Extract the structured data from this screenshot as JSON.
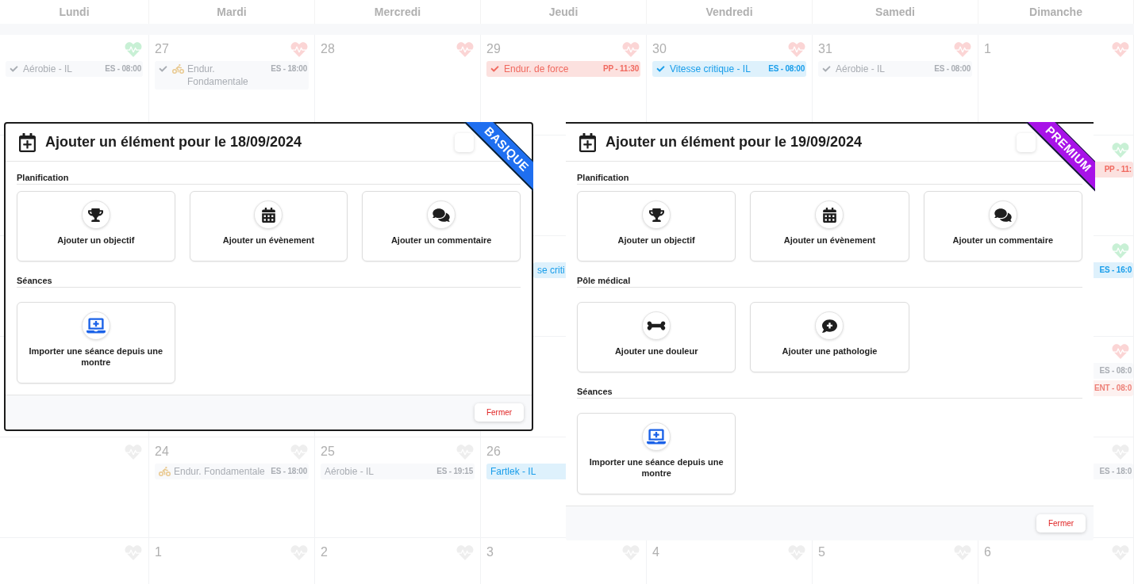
{
  "calendar": {
    "day_names": [
      "Lundi",
      "Mardi",
      "Mercredi",
      "Jeudi",
      "Vendredi",
      "Samedi",
      "Dimanche"
    ],
    "weeks": [
      {
        "days": [
          {
            "color": "#c8f0d5",
            "events": [
              {
                "kind": "workout",
                "completed": true,
                "title": "Aérobie - IL",
                "time": "ES - 08:00",
                "color": "#f8f9fb"
              }
            ]
          },
          {
            "number": "27",
            "color": "#fbd5d5",
            "events": [
              {
                "kind": "cycling",
                "completed": true,
                "title": "Endur. Fondamentale",
                "time": "ES - 18:00",
                "color": "#f8f9fb"
              }
            ]
          },
          {
            "number": "28",
            "color": "#fbd5d5"
          },
          {
            "number": "29",
            "color": "#fbd5d5",
            "events": [
              {
                "kind": "workout",
                "completed": true,
                "title": "Endur. de force",
                "time": "PP - 11:30",
                "color": "#fce1df"
              }
            ]
          },
          {
            "number": "30",
            "color": "#fbd5d5",
            "events": [
              {
                "kind": "workout",
                "completed": true,
                "title": "Vitesse critique - IL",
                "time": "ES - 08:00",
                "color": "#def1fc"
              }
            ]
          },
          {
            "number": "31",
            "color": "#fbd5d5",
            "events": [
              {
                "kind": "workout",
                "completed": true,
                "title": "Aérobie - IL",
                "time": "ES - 08:00",
                "color": "#f8f9fb"
              }
            ]
          },
          {
            "number": "1",
            "color": "#fbd5d5"
          }
        ]
      },
      {
        "sunday": {
          "color": "#c8f0d5",
          "events": [
            {
              "time": "PP - 11:",
              "color": "#fce1df"
            }
          ]
        }
      },
      {
        "thursday": {
          "events": [
            {
              "title": "se criti",
              "color": "#def1fc"
            }
          ]
        },
        "sunday": {
          "color": "#c8f0d5",
          "events": [
            {
              "time": "ES - 16:0",
              "color": "#def1fc"
            }
          ]
        }
      },
      {
        "sunday": {
          "color": "#fbd5d5",
          "events": [
            {
              "time": "ES - 08:0",
              "color": "#f8f9fb"
            },
            {
              "time": "ENT - 08:0",
              "color": "#fdf1f0"
            }
          ]
        }
      },
      {
        "days": [
          {
            "color": "#eeeeee"
          },
          {
            "number": "24",
            "color": "#eeeeee",
            "events": [
              {
                "kind": "cycling",
                "completed": false,
                "title": "Endur. Fondamentale",
                "time": "ES - 18:00",
                "color": "#f8f9fb"
              }
            ]
          },
          {
            "number": "25",
            "color": "#eeeeee",
            "events": [
              {
                "kind": "workout",
                "completed": false,
                "title": "Aérobie - IL",
                "time": "ES - 19:15",
                "color": "#f8f9fb"
              }
            ]
          },
          {
            "number": "26",
            "events": [
              {
                "kind": "workout",
                "completed": false,
                "title": "Fartlek - IL",
                "color": "#def1fc"
              }
            ]
          }
        ],
        "sunday": {
          "color": "#eeeeee",
          "events": [
            {
              "time": "ES - 18:0",
              "color": "#f8f9fb"
            }
          ]
        }
      },
      {
        "days": [
          {
            "color": "#eeeeee"
          },
          {
            "number": "1",
            "color": "#eeeeee"
          },
          {
            "number": "2",
            "color": "#eeeeee"
          },
          {
            "number": "3",
            "color": "#eeeeee"
          },
          {
            "number": "4",
            "color": "#eeeeee"
          },
          {
            "number": "5",
            "color": "#eeeeee"
          },
          {
            "number": "6",
            "color": "#eeeeee"
          }
        ]
      }
    ]
  },
  "dialogs": [
    {
      "title": "Ajouter un élément pour le 18/09/2024",
      "badge": {
        "label": "BASIQUE",
        "color": "#1f6ff0"
      },
      "sections": [
        {
          "label": "Planification",
          "actions": [
            {
              "kind": "objective",
              "label": "Ajouter un objectif"
            },
            {
              "kind": "event",
              "label": "Ajouter un évènement"
            },
            {
              "kind": "comment",
              "label": "Ajouter un commentaire"
            }
          ]
        },
        {
          "label": "Séances",
          "actions": [
            {
              "kind": "import",
              "label": "Importer une séance depuis une montre"
            }
          ]
        }
      ],
      "close_button": "Fermer"
    },
    {
      "title": "Ajouter un élément pour le 19/09/2024",
      "badge": {
        "label": "PREMIUM",
        "color": "#a812e8"
      },
      "sections": [
        {
          "label": "Planification",
          "actions": [
            {
              "kind": "objective",
              "label": "Ajouter un objectif"
            },
            {
              "kind": "event",
              "label": "Ajouter un évènement"
            },
            {
              "kind": "comment",
              "label": "Ajouter un commentaire"
            }
          ]
        },
        {
          "label": "Pôle médical",
          "actions": [
            {
              "kind": "pain",
              "label": "Ajouter une douleur"
            },
            {
              "kind": "pathology",
              "label": "Ajouter une pathologie"
            }
          ]
        },
        {
          "label": "Séances",
          "actions": [
            {
              "kind": "import",
              "label": "Importer une séance depuis une montre"
            }
          ]
        }
      ],
      "close_button": "Fermer"
    }
  ]
}
